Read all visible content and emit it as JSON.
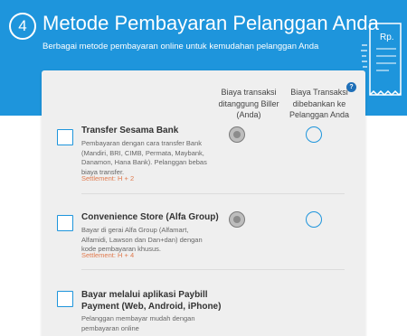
{
  "header": {
    "step_number": "4",
    "title": "Metode Pembayaran Pelanggan Anda",
    "subtitle": "Berbagai metode pembayaran online untuk kemudahan pelanggan Anda",
    "receipt_label": "Rp."
  },
  "table": {
    "help_label": "?",
    "columns": [
      "Biaya transaksi ditanggung Biller (Anda)",
      "Biaya Transaksi dibebankan ke Pelanggan Anda"
    ],
    "rows": [
      {
        "title": "Transfer Sesama Bank",
        "description": "Pembayaran dengan cara transfer Bank (Mandiri, BRI, CIMB, Permata, Maybank, Danamon, Hana Bank). Pelanggan bebas biaya transfer.",
        "settlement": "Settlement: H + 2",
        "selected": "biller"
      },
      {
        "title": "Convenience Store (Alfa Group)",
        "description": "Bayar di gerai Alfa Group (Alfamart, Alfamidi, Lawson dan Dan+dan) dengan kode pembayaran khusus.",
        "settlement": "Settlement: H + 4",
        "selected": "biller"
      },
      {
        "title": "Bayar melalui aplikasi Paybill Payment (Web, Android, iPhone)",
        "description": "Pelanggan membayar mudah dengan pembayaran online",
        "settlement": "",
        "selected": "none"
      }
    ]
  },
  "colors": {
    "primary_blue": "#1e95dc",
    "settlement_orange": "#e07a4e",
    "card_bg": "#efefef"
  }
}
